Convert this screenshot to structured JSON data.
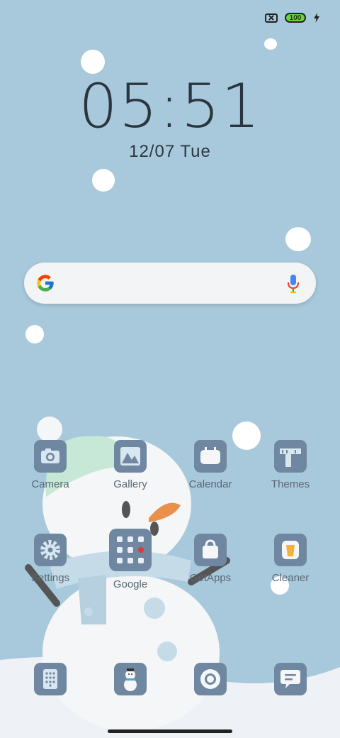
{
  "status_bar": {
    "battery_level": "100"
  },
  "lockclock": {
    "time": "05:51",
    "date": "12/07",
    "weekday": "Tue"
  },
  "search_bar": {
    "logo": "google-g-icon",
    "mic": "microphone-icon"
  },
  "apps": [
    {
      "label": "Camera",
      "icon": "camera-icon"
    },
    {
      "label": "Gallery",
      "icon": "gallery-icon"
    },
    {
      "label": "Calendar",
      "icon": "calendar-icon"
    },
    {
      "label": "Themes",
      "icon": "themes-icon"
    },
    {
      "label": "Settings",
      "icon": "gear-icon"
    },
    {
      "label": "Google",
      "icon": "folder-icon"
    },
    {
      "label": "GetApps",
      "icon": "shopping-bag-icon"
    },
    {
      "label": "Cleaner",
      "icon": "trash-icon"
    }
  ],
  "dock": [
    {
      "icon": "phone-dialer-icon"
    },
    {
      "icon": "snowman-icon"
    },
    {
      "icon": "browser-icon"
    },
    {
      "icon": "message-icon"
    }
  ],
  "colors": {
    "wallpaper": "#a8c9db",
    "icon_tile": "#6f87a1"
  }
}
